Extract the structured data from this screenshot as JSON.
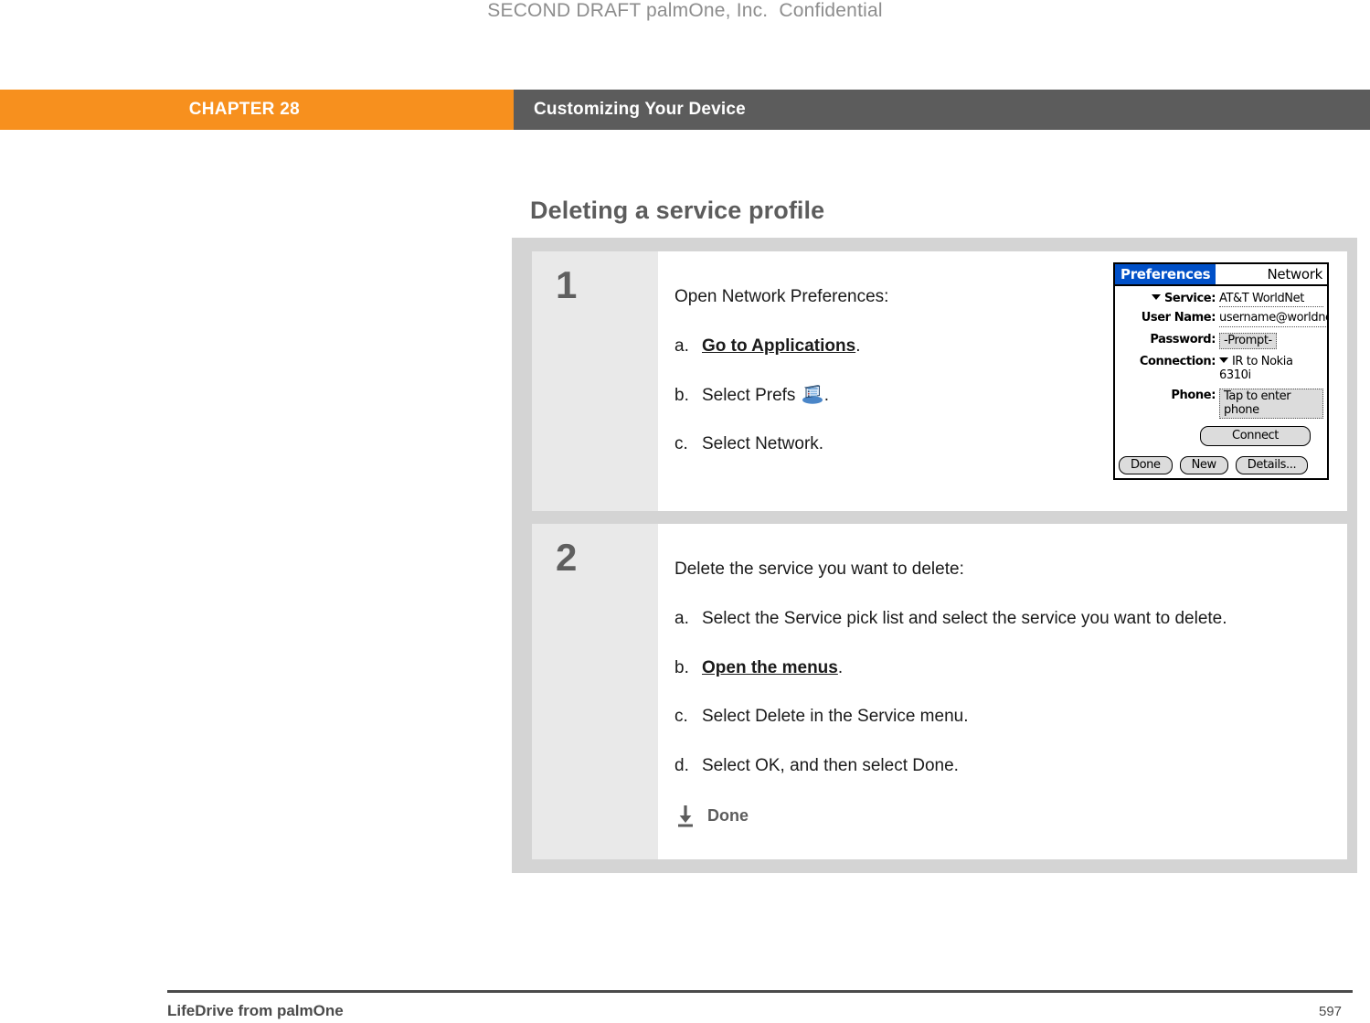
{
  "draft_notice": "SECOND DRAFT palmOne, Inc.  Confidential",
  "header": {
    "chapter_label": "CHAPTER 28",
    "section_label": "Customizing Your Device",
    "chapter_bg": "#f7901e",
    "section_bg": "#5c5c5c"
  },
  "section_title": "Deleting a service profile",
  "steps": [
    {
      "number": "1",
      "lead": "Open Network Preferences:",
      "items": [
        {
          "label": "a.",
          "text_before": "",
          "link": "Go to Applications",
          "text_after": ".",
          "icon": null
        },
        {
          "label": "b.",
          "text_before": "Select Prefs ",
          "link": null,
          "text_after": ".",
          "icon": "prefs-icon"
        },
        {
          "label": "c.",
          "text_before": "Select Network.",
          "link": null,
          "text_after": "",
          "icon": null
        }
      ],
      "done": null
    },
    {
      "number": "2",
      "lead": "Delete the service you want to delete:",
      "items": [
        {
          "label": "a.",
          "text_before": "Select the Service pick list and select the service you want to delete.",
          "link": null,
          "text_after": "",
          "icon": null
        },
        {
          "label": "b.",
          "text_before": "",
          "link": "Open the menus",
          "text_after": ".",
          "icon": null
        },
        {
          "label": "c.",
          "text_before": "Select Delete in the Service menu.",
          "link": null,
          "text_after": "",
          "icon": null
        },
        {
          "label": "d.",
          "text_before": "Select OK, and then select Done.",
          "link": null,
          "text_after": "",
          "icon": null
        }
      ],
      "done": {
        "icon": "down-arrow-to-bar-icon",
        "label": "Done"
      }
    }
  ],
  "palm_screen": {
    "title_tab": "Preferences",
    "title_right": "Network",
    "title_tab_color": "#0050c8",
    "fields": [
      {
        "label": "Service:",
        "value": "AT&T WorldNet",
        "type": "picklist"
      },
      {
        "label": "User Name:",
        "value": "username@worldnet.att.net",
        "type": "dotted"
      },
      {
        "label": "Password:",
        "value": "-Prompt-",
        "type": "box"
      },
      {
        "label": "Connection:",
        "value": "IR to Nokia 6310i",
        "type": "picklist"
      },
      {
        "label": "Phone:",
        "value": "Tap to enter phone",
        "type": "box"
      }
    ],
    "connect_button": "Connect",
    "bottom_buttons": [
      "Done",
      "New",
      "Details..."
    ]
  },
  "footer": {
    "product": "LifeDrive from palmOne",
    "page_number": "597"
  }
}
